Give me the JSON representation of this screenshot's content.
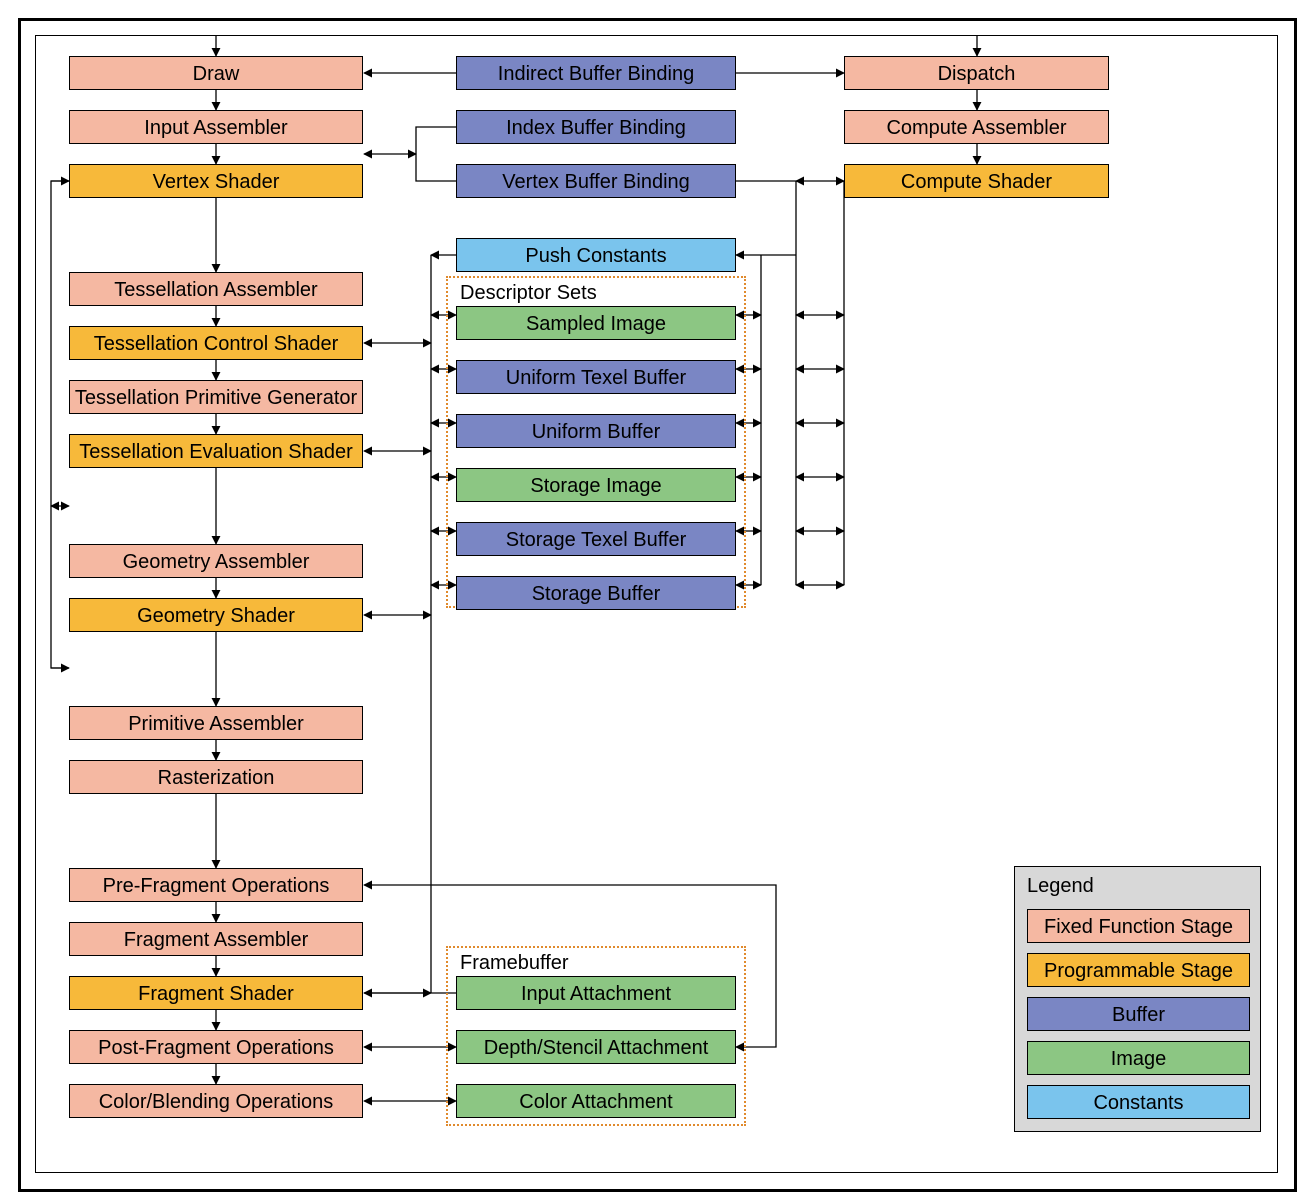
{
  "colors": {
    "fixed": "#f5b8a2",
    "programmable": "#f7b93a",
    "buffer": "#7a86c4",
    "image": "#8cc683",
    "constants": "#7ac4ed",
    "groupBorder": "#e08a2d"
  },
  "groups": {
    "descriptorSets": "Descriptor Sets",
    "framebuffer": "Framebuffer"
  },
  "legend": {
    "title": "Legend",
    "items": [
      "Fixed Function Stage",
      "Programmable Stage",
      "Buffer",
      "Image",
      "Constants"
    ]
  },
  "left": {
    "draw": "Draw",
    "inputAssembler": "Input Assembler",
    "vertexShader": "Vertex Shader",
    "tessAssembler": "Tessellation Assembler",
    "tessControl": "Tessellation Control Shader",
    "tessPrimGen": "Tessellation Primitive Generator",
    "tessEval": "Tessellation Evaluation Shader",
    "geomAssembler": "Geometry Assembler",
    "geomShader": "Geometry Shader",
    "primAssembler": "Primitive Assembler",
    "rasterization": "Rasterization",
    "preFrag": "Pre-Fragment Operations",
    "fragAssembler": "Fragment Assembler",
    "fragShader": "Fragment Shader",
    "postFrag": "Post-Fragment Operations",
    "colorBlend": "Color/Blending Operations"
  },
  "center": {
    "indirectBuf": "Indirect Buffer Binding",
    "indexBuf": "Index Buffer Binding",
    "vertexBuf": "Vertex Buffer Binding",
    "pushConst": "Push Constants",
    "sampledImg": "Sampled Image",
    "uniTexel": "Uniform Texel Buffer",
    "uniBuf": "Uniform Buffer",
    "storageImg": "Storage Image",
    "storageTexel": "Storage Texel Buffer",
    "storageBuf": "Storage Buffer",
    "inputAtt": "Input Attachment",
    "dsAtt": "Depth/Stencil Attachment",
    "colorAtt": "Color Attachment"
  },
  "right": {
    "dispatch": "Dispatch",
    "computeAssembler": "Compute Assembler",
    "computeShader": "Compute Shader"
  }
}
